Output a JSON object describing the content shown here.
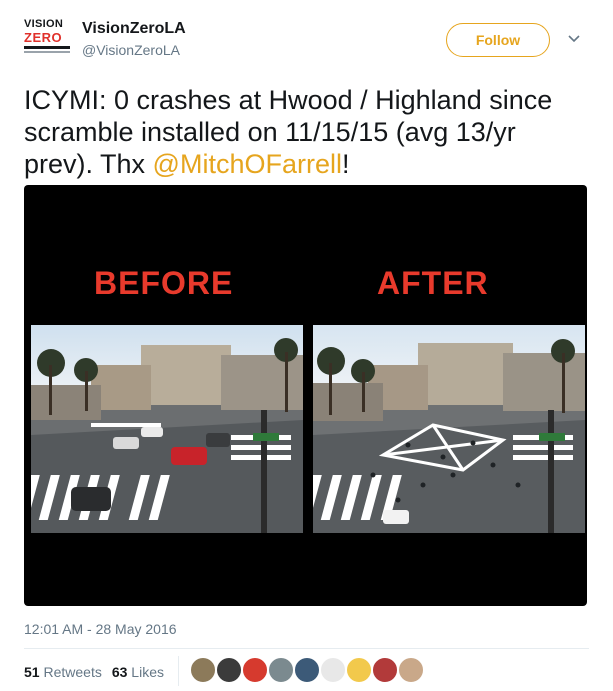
{
  "account": {
    "logo_text_top": "VISION",
    "logo_text_bottom": "ZERO",
    "display_name": "VisionZeroLA",
    "screen_name": "@VisionZeroLA",
    "follow_label": "Follow"
  },
  "tweet": {
    "text_before_mention": "ICYMI: 0 crashes at Hwood / Highland since scramble installed on 11/15/15 (avg 13/yr prev). Thx ",
    "mention": "@MitchOFarrell",
    "text_after_mention": "!",
    "timestamp": "12:01 AM - 28 May 2016"
  },
  "media": {
    "before_label": "BEFORE",
    "after_label": "AFTER"
  },
  "stats": {
    "retweets_count": "51",
    "retweets_label": "Retweets",
    "likes_count": "63",
    "likes_label": "Likes"
  },
  "colors": {
    "accent": "#e6a51e",
    "label_red": "#e83a2c",
    "muted": "#657786"
  },
  "likers": [
    {
      "icon": "avatar-1",
      "color": "#8c7a5a"
    },
    {
      "icon": "avatar-2",
      "color": "#3b3b3b"
    },
    {
      "icon": "avatar-3",
      "color": "#d63a2e"
    },
    {
      "icon": "avatar-4",
      "color": "#7b8a8f"
    },
    {
      "icon": "avatar-5",
      "color": "#3c5a78"
    },
    {
      "icon": "avatar-6",
      "color": "#e8e8e8"
    },
    {
      "icon": "avatar-7",
      "color": "#f2c94c"
    },
    {
      "icon": "avatar-8",
      "color": "#b23a3a"
    },
    {
      "icon": "avatar-9",
      "color": "#c9a889"
    }
  ]
}
